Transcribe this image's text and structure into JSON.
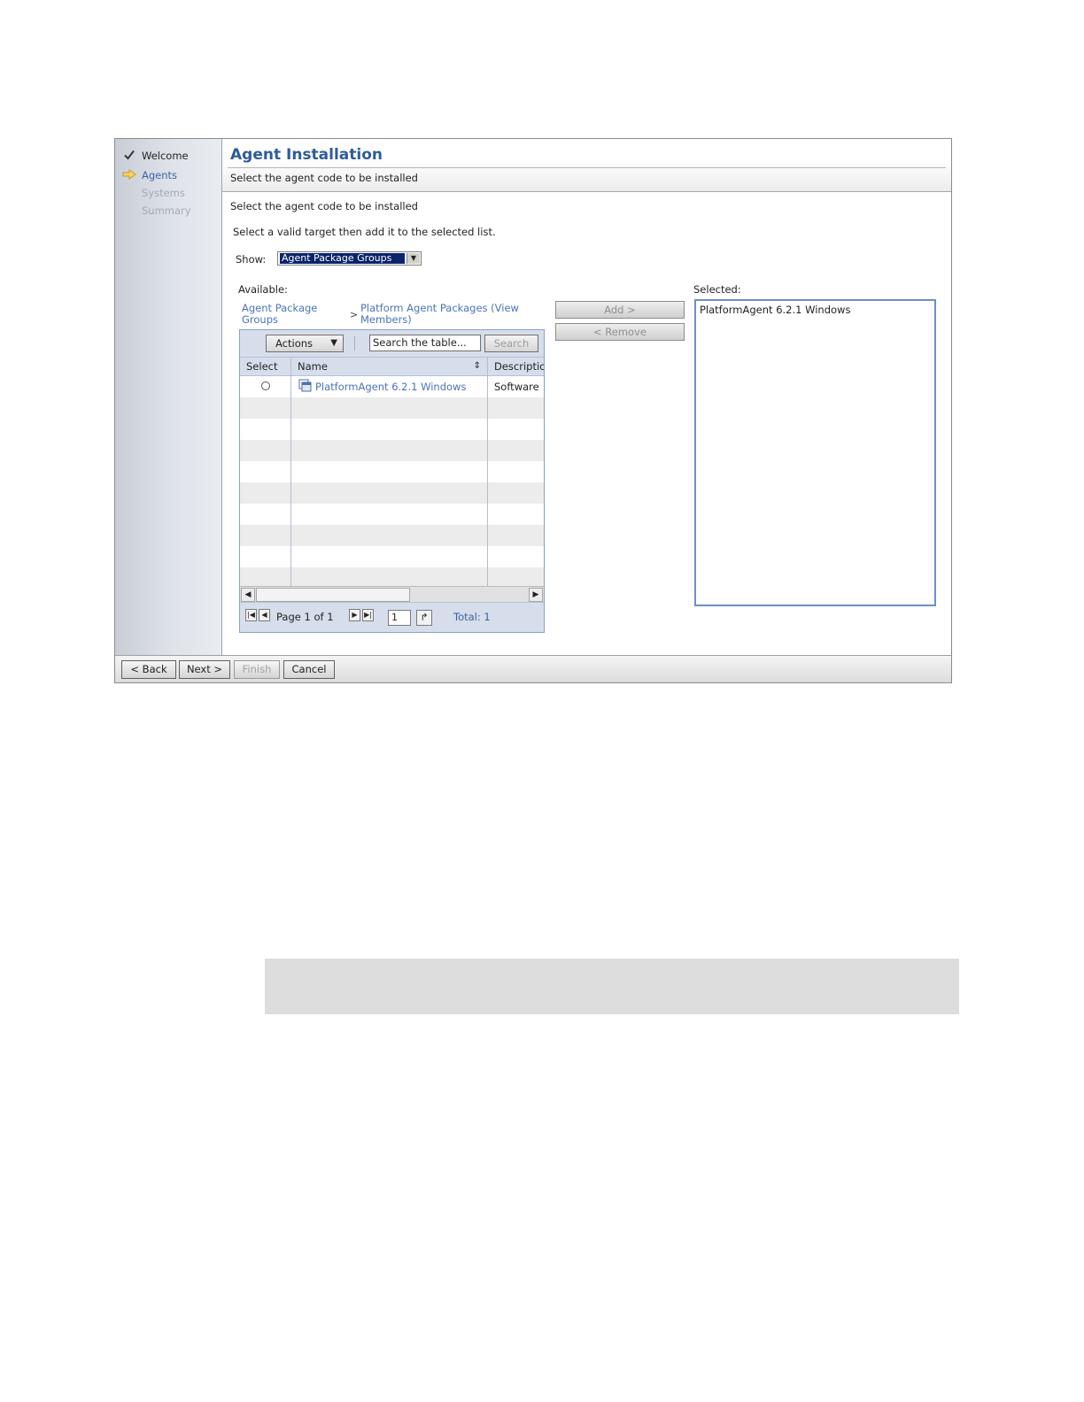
{
  "wizard": {
    "title": "Agent Installation",
    "subtitle": "Select the agent code to be installed",
    "steps": [
      {
        "label": "Welcome",
        "state": "done",
        "icon": "checkmark-icon"
      },
      {
        "label": "Agents",
        "state": "current",
        "icon": "arrow-right-icon"
      },
      {
        "label": "Systems",
        "state": "future"
      },
      {
        "label": "Summary",
        "state": "future"
      }
    ]
  },
  "content": {
    "intro": "Select the agent code to be installed",
    "instruction": "Select a valid target then add it to the selected list.",
    "show_label": "Show:",
    "show_value": "Agent Package Groups",
    "available_label": "Available:",
    "selected_label": "Selected:",
    "breadcrumb": {
      "root": "Agent Package Groups",
      "separator": ">",
      "current": "Platform Agent Packages (View Members)"
    }
  },
  "table": {
    "actions_label": "Actions",
    "search_placeholder": "Search the table...",
    "search_button": "Search",
    "columns": [
      "Select",
      "Name",
      "Descriptic"
    ],
    "rows": [
      {
        "name": "PlatformAgent 6.2.1 Windows",
        "description": "Software"
      }
    ],
    "pager": {
      "page_text": "Page 1 of 1",
      "page_input": "1",
      "total_text": "Total: 1"
    }
  },
  "transfer": {
    "add_label": "Add >",
    "remove_label": "< Remove",
    "selected_items": [
      "PlatformAgent 6.2.1 Windows"
    ]
  },
  "footer": {
    "back_label": "< Back",
    "next_label": "Next >",
    "finish_label": "Finish",
    "cancel_label": "Cancel"
  },
  "colors": {
    "title": "#2e5b9a",
    "link": "#4a73b8",
    "table_header": "#d7deeb",
    "selection": "#0a246a"
  }
}
